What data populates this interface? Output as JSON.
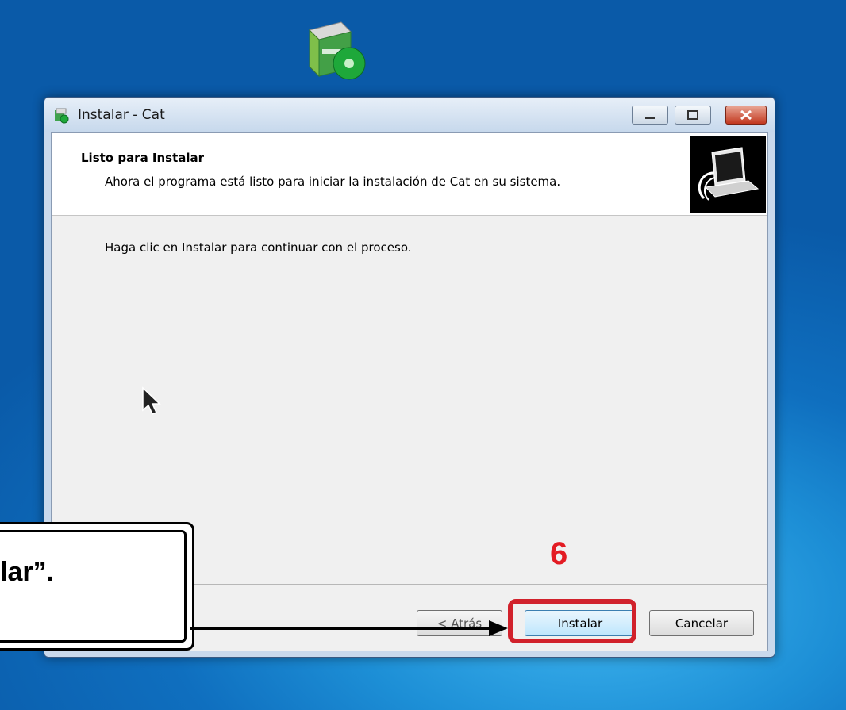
{
  "window": {
    "title": "Instalar - Cat",
    "controls": {
      "minimize": "minimize",
      "maximize": "maximize",
      "close": "close"
    }
  },
  "header": {
    "title": "Listo para Instalar",
    "subtitle": "Ahora el programa está listo para iniciar la instalación de Cat en su sistema."
  },
  "body": {
    "message": "Haga clic en Instalar para continuar con el proceso."
  },
  "buttons": {
    "back": "< Atrás",
    "install": "Instalar",
    "cancel": "Cancelar"
  },
  "annotation": {
    "step_number": "6",
    "callout_text": "lar”.",
    "highlight_color": "#d1212b",
    "step_color": "#e31b23"
  },
  "icons": {
    "desktop": "setup-box-cd-icon",
    "title": "installer-icon",
    "header_image": "computer-install-icon",
    "cursor": "mouse-pointer-icon"
  }
}
